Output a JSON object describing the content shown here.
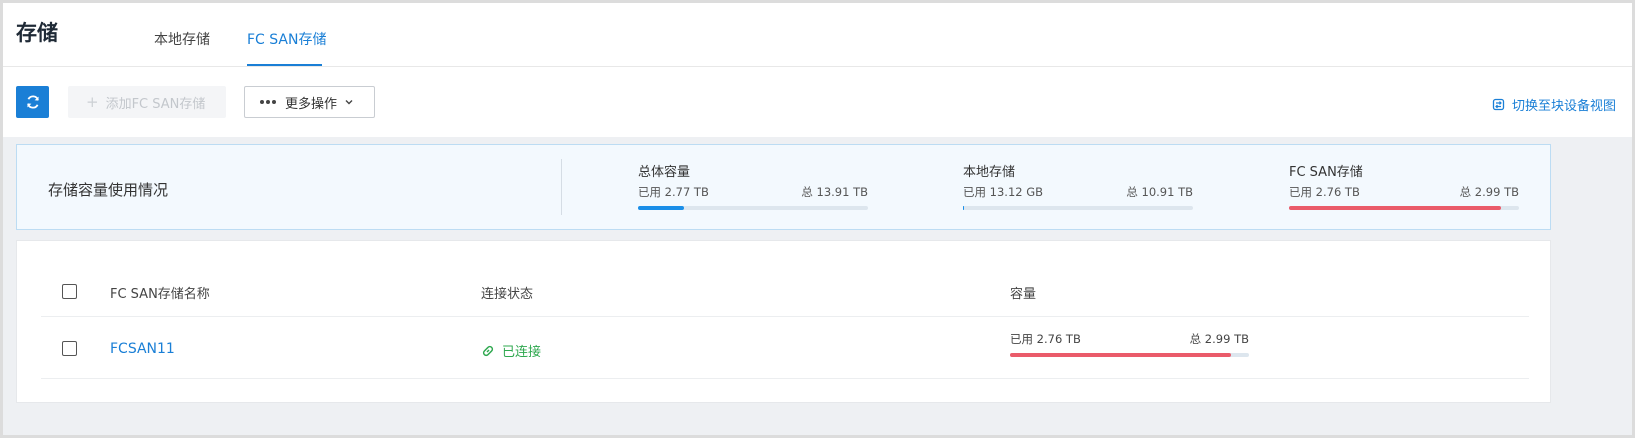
{
  "header": {
    "title": "存储",
    "tabs": [
      {
        "label": "本地存储",
        "active": false
      },
      {
        "label": "FC SAN存储",
        "active": true
      }
    ]
  },
  "toolbar": {
    "add_label": "添加FC SAN存储",
    "more_label": "更多操作",
    "switch_view_label": "切换至块设备视图"
  },
  "summary": {
    "title": "存储容量使用情况",
    "metrics": [
      {
        "label": "总体容量",
        "used": "已用 2.77 TB",
        "total": "总 13.91 TB",
        "ratio": 0.199,
        "color": "#1a8ee8"
      },
      {
        "label": "本地存储",
        "used": "已用 13.12 GB",
        "total": "总 10.91 TB",
        "ratio": 0.001,
        "color": "#1a8ee8"
      },
      {
        "label": "FC SAN存储",
        "used": "已用 2.76 TB",
        "total": "总 2.99 TB",
        "ratio": 0.923,
        "color": "#ea5b6a"
      }
    ]
  },
  "table": {
    "columns": [
      "FC SAN存储名称",
      "连接状态",
      "容量"
    ],
    "rows": [
      {
        "name": "FCSAN11",
        "status": "已连接",
        "used": "已用 2.76 TB",
        "total": "总 2.99 TB",
        "ratio": 0.923
      }
    ]
  },
  "colors": {
    "accent": "#1a7fd6",
    "success": "#2fa84f",
    "danger": "#ea5b6a"
  }
}
